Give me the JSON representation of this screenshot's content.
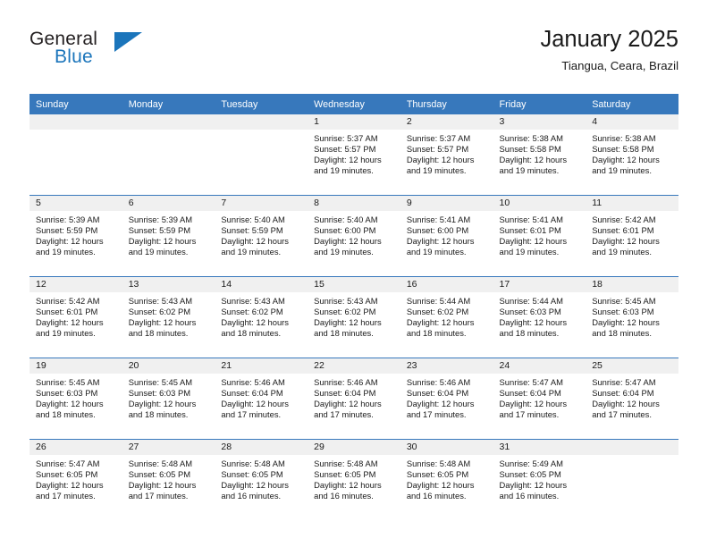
{
  "brand": {
    "word_one": "General",
    "word_two": "Blue",
    "logo_icon": "triangle-logo-icon",
    "accent_color": "#1b75bb"
  },
  "header": {
    "title": "January 2025",
    "subtitle": "Tiangua, Ceara, Brazil"
  },
  "calendar": {
    "header_color": "#3778bc",
    "daynum_bg": "#f0f0f0",
    "weekdays": [
      "Sunday",
      "Monday",
      "Tuesday",
      "Wednesday",
      "Thursday",
      "Friday",
      "Saturday"
    ],
    "weeks": [
      [
        {
          "day": "",
          "sunrise": "",
          "sunset": "",
          "daylight": ""
        },
        {
          "day": "",
          "sunrise": "",
          "sunset": "",
          "daylight": ""
        },
        {
          "day": "",
          "sunrise": "",
          "sunset": "",
          "daylight": ""
        },
        {
          "day": "1",
          "sunrise": "Sunrise: 5:37 AM",
          "sunset": "Sunset: 5:57 PM",
          "daylight": "Daylight: 12 hours and 19 minutes."
        },
        {
          "day": "2",
          "sunrise": "Sunrise: 5:37 AM",
          "sunset": "Sunset: 5:57 PM",
          "daylight": "Daylight: 12 hours and 19 minutes."
        },
        {
          "day": "3",
          "sunrise": "Sunrise: 5:38 AM",
          "sunset": "Sunset: 5:58 PM",
          "daylight": "Daylight: 12 hours and 19 minutes."
        },
        {
          "day": "4",
          "sunrise": "Sunrise: 5:38 AM",
          "sunset": "Sunset: 5:58 PM",
          "daylight": "Daylight: 12 hours and 19 minutes."
        }
      ],
      [
        {
          "day": "5",
          "sunrise": "Sunrise: 5:39 AM",
          "sunset": "Sunset: 5:59 PM",
          "daylight": "Daylight: 12 hours and 19 minutes."
        },
        {
          "day": "6",
          "sunrise": "Sunrise: 5:39 AM",
          "sunset": "Sunset: 5:59 PM",
          "daylight": "Daylight: 12 hours and 19 minutes."
        },
        {
          "day": "7",
          "sunrise": "Sunrise: 5:40 AM",
          "sunset": "Sunset: 5:59 PM",
          "daylight": "Daylight: 12 hours and 19 minutes."
        },
        {
          "day": "8",
          "sunrise": "Sunrise: 5:40 AM",
          "sunset": "Sunset: 6:00 PM",
          "daylight": "Daylight: 12 hours and 19 minutes."
        },
        {
          "day": "9",
          "sunrise": "Sunrise: 5:41 AM",
          "sunset": "Sunset: 6:00 PM",
          "daylight": "Daylight: 12 hours and 19 minutes."
        },
        {
          "day": "10",
          "sunrise": "Sunrise: 5:41 AM",
          "sunset": "Sunset: 6:01 PM",
          "daylight": "Daylight: 12 hours and 19 minutes."
        },
        {
          "day": "11",
          "sunrise": "Sunrise: 5:42 AM",
          "sunset": "Sunset: 6:01 PM",
          "daylight": "Daylight: 12 hours and 19 minutes."
        }
      ],
      [
        {
          "day": "12",
          "sunrise": "Sunrise: 5:42 AM",
          "sunset": "Sunset: 6:01 PM",
          "daylight": "Daylight: 12 hours and 19 minutes."
        },
        {
          "day": "13",
          "sunrise": "Sunrise: 5:43 AM",
          "sunset": "Sunset: 6:02 PM",
          "daylight": "Daylight: 12 hours and 18 minutes."
        },
        {
          "day": "14",
          "sunrise": "Sunrise: 5:43 AM",
          "sunset": "Sunset: 6:02 PM",
          "daylight": "Daylight: 12 hours and 18 minutes."
        },
        {
          "day": "15",
          "sunrise": "Sunrise: 5:43 AM",
          "sunset": "Sunset: 6:02 PM",
          "daylight": "Daylight: 12 hours and 18 minutes."
        },
        {
          "day": "16",
          "sunrise": "Sunrise: 5:44 AM",
          "sunset": "Sunset: 6:02 PM",
          "daylight": "Daylight: 12 hours and 18 minutes."
        },
        {
          "day": "17",
          "sunrise": "Sunrise: 5:44 AM",
          "sunset": "Sunset: 6:03 PM",
          "daylight": "Daylight: 12 hours and 18 minutes."
        },
        {
          "day": "18",
          "sunrise": "Sunrise: 5:45 AM",
          "sunset": "Sunset: 6:03 PM",
          "daylight": "Daylight: 12 hours and 18 minutes."
        }
      ],
      [
        {
          "day": "19",
          "sunrise": "Sunrise: 5:45 AM",
          "sunset": "Sunset: 6:03 PM",
          "daylight": "Daylight: 12 hours and 18 minutes."
        },
        {
          "day": "20",
          "sunrise": "Sunrise: 5:45 AM",
          "sunset": "Sunset: 6:03 PM",
          "daylight": "Daylight: 12 hours and 18 minutes."
        },
        {
          "day": "21",
          "sunrise": "Sunrise: 5:46 AM",
          "sunset": "Sunset: 6:04 PM",
          "daylight": "Daylight: 12 hours and 17 minutes."
        },
        {
          "day": "22",
          "sunrise": "Sunrise: 5:46 AM",
          "sunset": "Sunset: 6:04 PM",
          "daylight": "Daylight: 12 hours and 17 minutes."
        },
        {
          "day": "23",
          "sunrise": "Sunrise: 5:46 AM",
          "sunset": "Sunset: 6:04 PM",
          "daylight": "Daylight: 12 hours and 17 minutes."
        },
        {
          "day": "24",
          "sunrise": "Sunrise: 5:47 AM",
          "sunset": "Sunset: 6:04 PM",
          "daylight": "Daylight: 12 hours and 17 minutes."
        },
        {
          "day": "25",
          "sunrise": "Sunrise: 5:47 AM",
          "sunset": "Sunset: 6:04 PM",
          "daylight": "Daylight: 12 hours and 17 minutes."
        }
      ],
      [
        {
          "day": "26",
          "sunrise": "Sunrise: 5:47 AM",
          "sunset": "Sunset: 6:05 PM",
          "daylight": "Daylight: 12 hours and 17 minutes."
        },
        {
          "day": "27",
          "sunrise": "Sunrise: 5:48 AM",
          "sunset": "Sunset: 6:05 PM",
          "daylight": "Daylight: 12 hours and 17 minutes."
        },
        {
          "day": "28",
          "sunrise": "Sunrise: 5:48 AM",
          "sunset": "Sunset: 6:05 PM",
          "daylight": "Daylight: 12 hours and 16 minutes."
        },
        {
          "day": "29",
          "sunrise": "Sunrise: 5:48 AM",
          "sunset": "Sunset: 6:05 PM",
          "daylight": "Daylight: 12 hours and 16 minutes."
        },
        {
          "day": "30",
          "sunrise": "Sunrise: 5:48 AM",
          "sunset": "Sunset: 6:05 PM",
          "daylight": "Daylight: 12 hours and 16 minutes."
        },
        {
          "day": "31",
          "sunrise": "Sunrise: 5:49 AM",
          "sunset": "Sunset: 6:05 PM",
          "daylight": "Daylight: 12 hours and 16 minutes."
        },
        {
          "day": "",
          "sunrise": "",
          "sunset": "",
          "daylight": ""
        }
      ]
    ]
  }
}
